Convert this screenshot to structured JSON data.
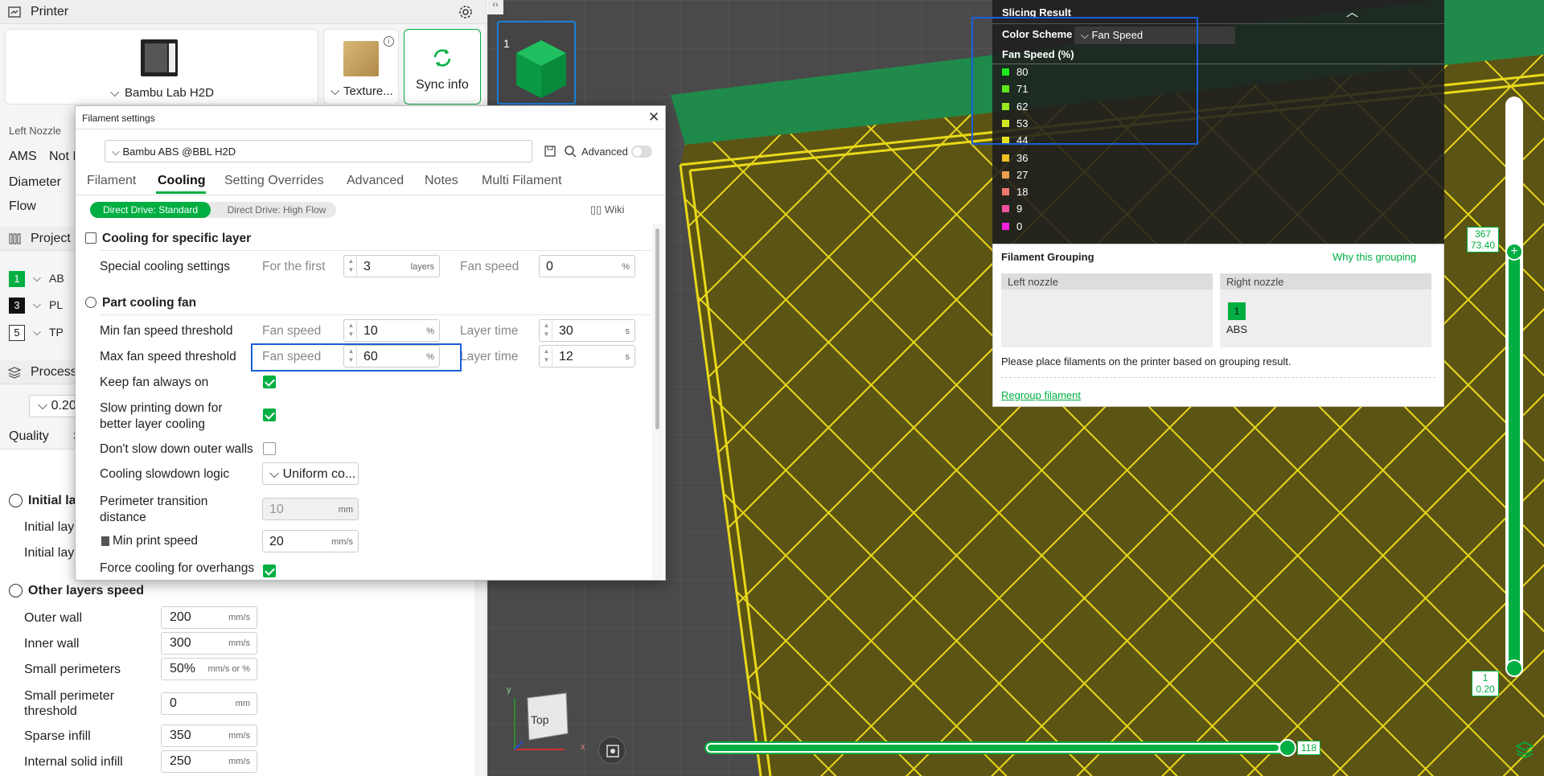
{
  "printer": {
    "title": "Printer",
    "model": "Bambu Lab H2D",
    "plate": "Texture...",
    "sync_label": "Sync info",
    "left_nozzle": "Left Nozzle",
    "ams_label": "AMS",
    "ams_value": "Not I",
    "diameter_label": "Diameter",
    "flow_label": "Flow"
  },
  "project_filaments": {
    "title": "Project F",
    "items": [
      {
        "num": "1",
        "name": "AB",
        "color": "#00ae42"
      },
      {
        "num": "3",
        "name": "PL",
        "color": "#111111"
      },
      {
        "num": "5",
        "name": "TP",
        "color": "#ffffff"
      }
    ]
  },
  "process": {
    "title": "Process",
    "layer": "0.20",
    "quality_tab": "Quality",
    "s_tab": "S",
    "initial_layer_title": "Initial lay",
    "initial_layer_row1": "Initial lay",
    "initial_layer_row2": "Initial lay",
    "other_layers_title": "Other layers speed",
    "rows": [
      {
        "label": "Outer wall",
        "value": "200",
        "unit": "mm/s"
      },
      {
        "label": "Inner wall",
        "value": "300",
        "unit": "mm/s"
      },
      {
        "label": "Small perimeters",
        "value": "50%",
        "unit": "mm/s or %"
      },
      {
        "label": "Small perimeter threshold",
        "value": "0",
        "unit": "mm"
      },
      {
        "label": "Sparse infill",
        "value": "350",
        "unit": "mm/s"
      },
      {
        "label": "Internal solid infill",
        "value": "250",
        "unit": "mm/s"
      }
    ]
  },
  "dialog": {
    "title": "Filament settings",
    "preset": "Bambu ABS @BBL H2D",
    "advanced_label": "Advanced",
    "tabs": [
      "Filament",
      "Cooling",
      "Setting Overrides",
      "Advanced",
      "Notes",
      "Multi Filament"
    ],
    "active_tab": "Cooling",
    "subtabs": [
      "Direct Drive: Standard",
      "Direct Drive: High Flow"
    ],
    "wiki": "Wiki",
    "section1": "Cooling for specific layer",
    "special_label": "Special cooling settings",
    "for_first_label": "For the first",
    "for_first_value": "3",
    "for_first_unit": "layers",
    "fan_speed_label": "Fan speed",
    "special_fan_value": "0",
    "pct": "%",
    "section2": "Part cooling fan",
    "min_label": "Min fan speed threshold",
    "min_fan": "10",
    "min_layer_time": "30",
    "max_label": "Max fan speed threshold",
    "max_fan": "60",
    "max_layer_time": "12",
    "layer_time_label": "Layer time",
    "s_unit": "s",
    "keep_fan_label": "Keep fan always on",
    "slow_down_label": "Slow printing down for better layer cooling",
    "dont_slow_label": "Don't slow down outer walls",
    "logic_label": "Cooling slowdown logic",
    "logic_value": "Uniform co...",
    "perimeter_label": "Perimeter transition distance",
    "perimeter_value": "10",
    "mm_unit": "mm",
    "min_print_label": "Min print speed",
    "min_print_value": "20",
    "mms_unit": "mm/s",
    "force_cooling_label": "Force cooling for overhangs"
  },
  "slicing": {
    "title": "Slicing Result",
    "color_scheme_label": "Color Scheme",
    "scheme_value": "Fan Speed",
    "legend_title": "Fan Speed (%)",
    "legend": [
      {
        "value": "80",
        "color": "#1ee81e"
      },
      {
        "value": "71",
        "color": "#5ee81e"
      },
      {
        "value": "62",
        "color": "#9be81e"
      },
      {
        "value": "53",
        "color": "#d2e81e"
      },
      {
        "value": "44",
        "color": "#e8e01e"
      },
      {
        "value": "36",
        "color": "#f0c020"
      },
      {
        "value": "27",
        "color": "#f0a050"
      },
      {
        "value": "18",
        "color": "#f07870"
      },
      {
        "value": "9",
        "color": "#f050a0"
      },
      {
        "value": "0",
        "color": "#f020e0"
      }
    ]
  },
  "grouping": {
    "title": "Filament Grouping",
    "why_link": "Why this grouping",
    "left_nozzle": "Left nozzle",
    "right_nozzle": "Right nozzle",
    "slot_num": "1",
    "slot_name": "ABS",
    "note": "Please place filaments on the printer based on grouping result.",
    "regroup": "Regroup filament"
  },
  "viewport": {
    "plate_num": "1",
    "top_label": "Top",
    "vslider_top_layer": "367",
    "vslider_top_height": "73.40",
    "vslider_bottom_layer": "1",
    "vslider_bottom_height": "0.20",
    "hslider_value": "118",
    "axis_x": "x",
    "axis_y": "y"
  },
  "colors": {
    "accent": "#00ae42",
    "highlight": "#1a5fd9",
    "model": "#d4c21a"
  }
}
